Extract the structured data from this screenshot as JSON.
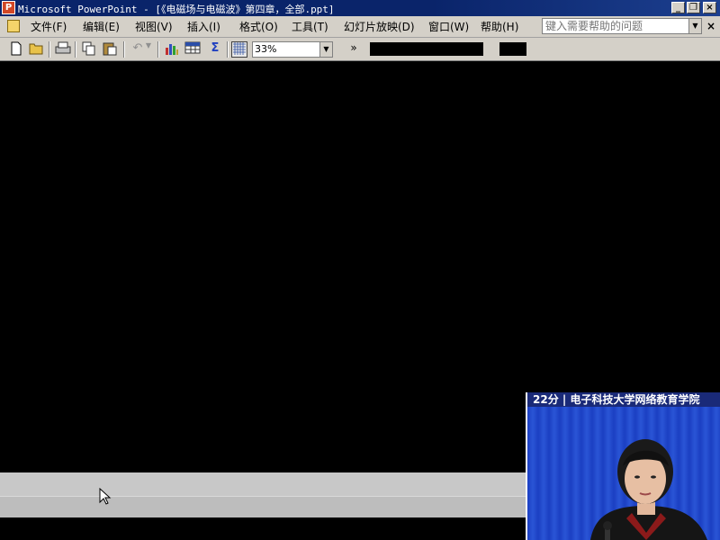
{
  "window": {
    "title": "Microsoft PowerPoint - [《电磁场与电磁波》第四章，全部.ppt]",
    "app_icon_letter": "P",
    "buttons": [
      "_",
      "❐",
      "×"
    ]
  },
  "menubar": {
    "items": [
      "文件(F)",
      "编辑(E)",
      "视图(V)",
      "插入(I)",
      "格式(O)",
      "工具(T)",
      "幻灯片放映(D)",
      "窗口(W)",
      "帮助(H)"
    ],
    "help_placeholder": "键入需要帮助的问题",
    "close_glyph": "×"
  },
  "toolbar": {
    "icons": [
      "new-icon",
      "open-icon",
      "print-icon",
      "copy-icon",
      "paste-icon",
      "undo-icon",
      "chart-icon",
      "table-icon",
      "sigma-icon",
      "grid-icon"
    ],
    "sigma": "Σ",
    "zoom": "33%",
    "more": "»"
  },
  "video": {
    "caption": "22分 | 电子科技大学网络教育学院"
  },
  "colors": {
    "title_bar": "#0a246a",
    "chrome": "#d4d0c8",
    "video_header": "#1a2a78",
    "video_bg": "#1b3fc2"
  }
}
